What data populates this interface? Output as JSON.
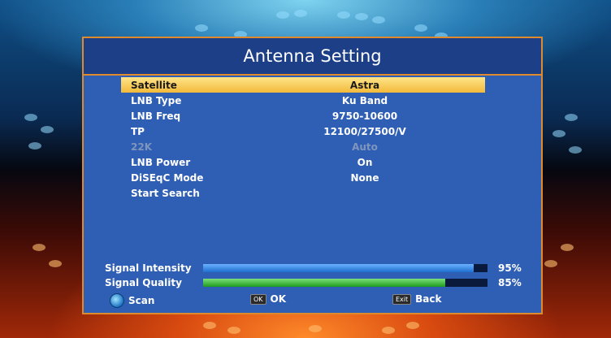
{
  "dialog": {
    "title": "Antenna Setting"
  },
  "menu": [
    {
      "label": "Satellite",
      "value": "Astra"
    },
    {
      "label": "LNB Type",
      "value": "Ku Band"
    },
    {
      "label": "LNB Freq",
      "value": "9750-10600"
    },
    {
      "label": "TP",
      "value": "12100/27500/V"
    },
    {
      "label": "22K",
      "value": "Auto"
    },
    {
      "label": "LNB Power",
      "value": "On"
    },
    {
      "label": "DiSEqC Mode",
      "value": "None"
    },
    {
      "label": "Start Search",
      "value": ""
    }
  ],
  "signal": {
    "intensity": {
      "label": "Signal Intensity",
      "percent": 95,
      "percent_text": "95%"
    },
    "quality": {
      "label": "Signal Quality",
      "percent": 85,
      "percent_text": "85%"
    }
  },
  "footer": {
    "scan_label": "Scan",
    "ok_key": "OK",
    "ok_label": "OK",
    "exit_key": "Exit",
    "back_label": "Back"
  },
  "colors": {
    "frame": "#e08a2e",
    "panel": "#2f5fb4",
    "highlight": "#f5c84a"
  }
}
